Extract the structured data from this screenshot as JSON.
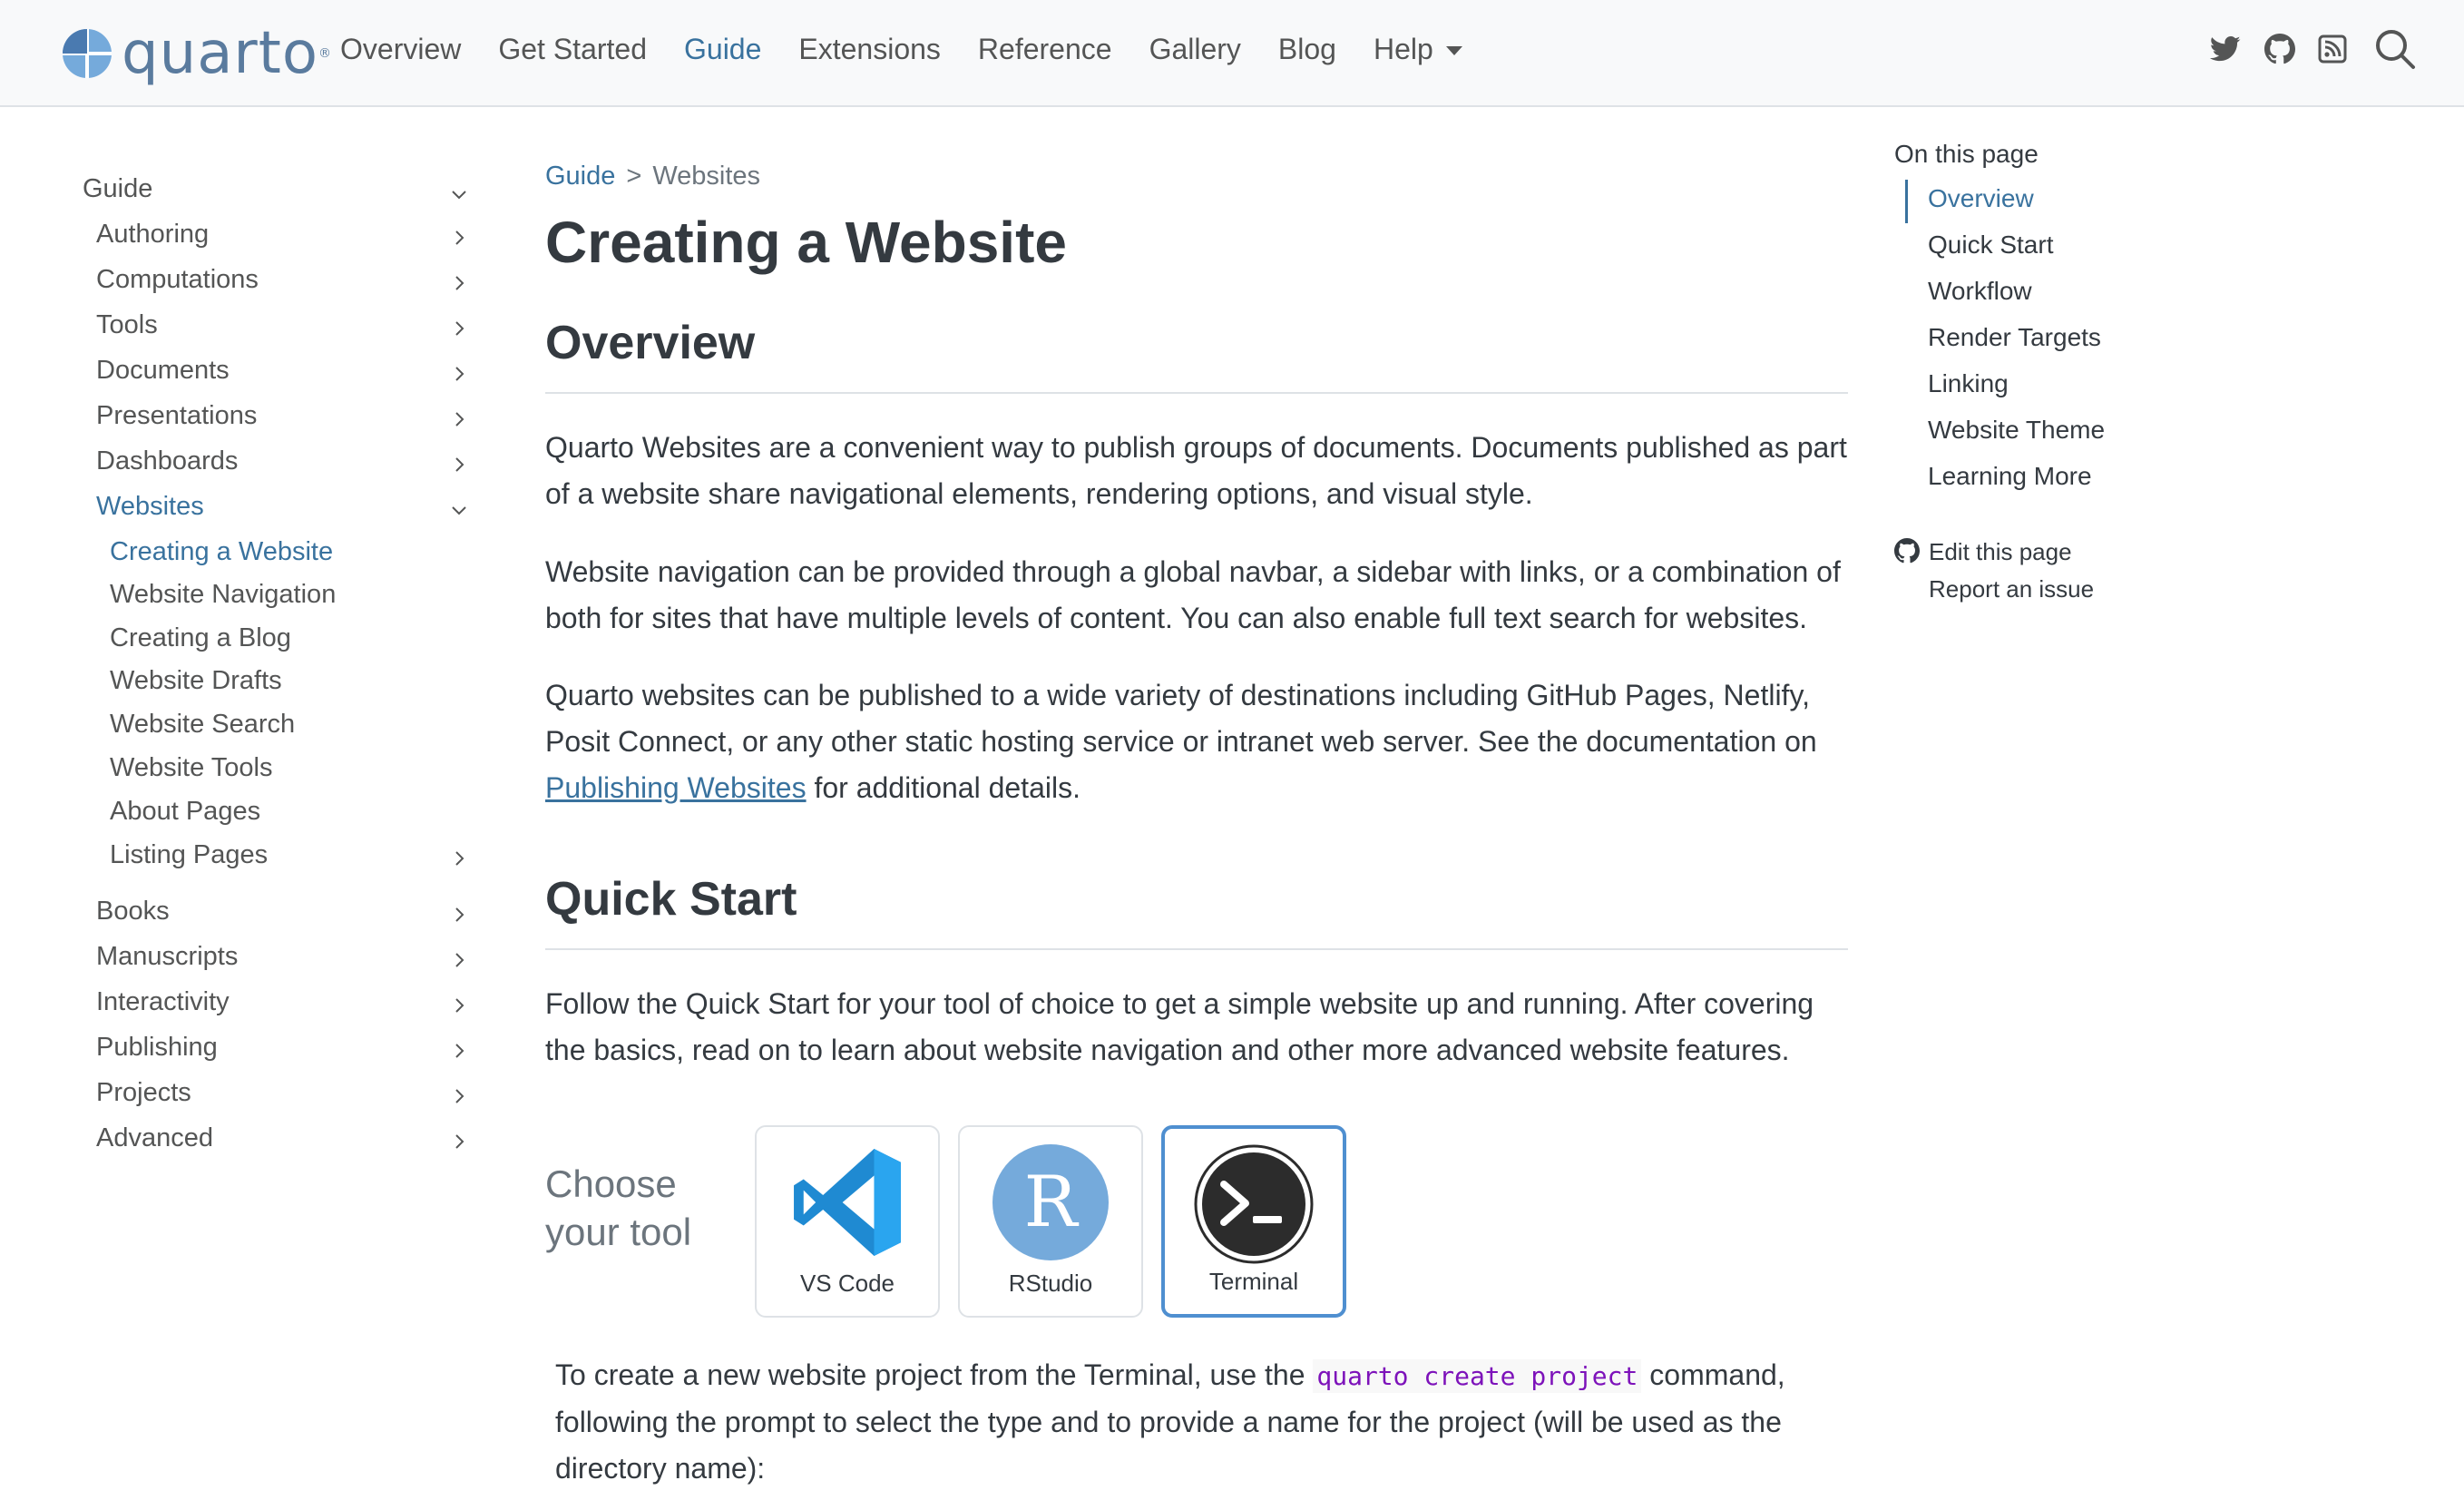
{
  "navbar": {
    "brand": "quarto",
    "brand_mark": "®",
    "links": [
      "Overview",
      "Get Started",
      "Guide",
      "Extensions",
      "Reference",
      "Gallery",
      "Blog",
      "Help"
    ],
    "active_link": "Guide",
    "icons": [
      "twitter-icon",
      "github-icon",
      "rss-icon",
      "search-icon"
    ]
  },
  "sidebar": {
    "sections": [
      {
        "label": "Guide",
        "level": 0,
        "expanded": true
      },
      {
        "label": "Authoring",
        "level": 1,
        "expanded": false
      },
      {
        "label": "Computations",
        "level": 1,
        "expanded": false
      },
      {
        "label": "Tools",
        "level": 1,
        "expanded": false
      },
      {
        "label": "Documents",
        "level": 1,
        "expanded": false
      },
      {
        "label": "Presentations",
        "level": 1,
        "expanded": false
      },
      {
        "label": "Dashboards",
        "level": 1,
        "expanded": false
      },
      {
        "label": "Websites",
        "level": 1,
        "expanded": true,
        "active": true
      },
      {
        "label": "Creating a Website",
        "level": 2,
        "active": true
      },
      {
        "label": "Website Navigation",
        "level": 2
      },
      {
        "label": "Creating a Blog",
        "level": 2
      },
      {
        "label": "Website Drafts",
        "level": 2
      },
      {
        "label": "Website Search",
        "level": 2
      },
      {
        "label": "Website Tools",
        "level": 2
      },
      {
        "label": "About Pages",
        "level": 2
      },
      {
        "label": "Listing Pages",
        "level": 2,
        "expanded": false
      },
      {
        "label": "Books",
        "level": 1,
        "expanded": false
      },
      {
        "label": "Manuscripts",
        "level": 1,
        "expanded": false
      },
      {
        "label": "Interactivity",
        "level": 1,
        "expanded": false
      },
      {
        "label": "Publishing",
        "level": 1,
        "expanded": false
      },
      {
        "label": "Projects",
        "level": 1,
        "expanded": false
      },
      {
        "label": "Advanced",
        "level": 1,
        "expanded": false
      }
    ]
  },
  "breadcrumb": {
    "parent": "Guide",
    "separator": ">",
    "current": "Websites"
  },
  "page": {
    "title": "Creating a Website",
    "overview_heading": "Overview",
    "overview_p1": "Quarto Websites are a convenient way to publish groups of documents. Documents published as part of a website share navigational elements, rendering options, and visual style.",
    "overview_p2": "Website navigation can be provided through a global navbar, a sidebar with links, or a combination of both for sites that have multiple levels of content. You can also enable full text search for websites.",
    "overview_p3_before": "Quarto websites can be published to a wide variety of destinations including GitHub Pages, Netlify, Posit Connect, or any other static hosting service or intranet web server. See the documentation on ",
    "overview_p3_link": "Publishing Websites",
    "overview_p3_after": " for additional details.",
    "quickstart_heading": "Quick Start",
    "quickstart_p1": "Follow the Quick Start for your tool of choice to get a simple website up and running. After covering the basics, read on to learn about website navigation and other more advanced website features.",
    "choose_line1": "Choose",
    "choose_line2": "your tool",
    "tools": [
      {
        "label": "VS Code",
        "icon": "vscode-icon",
        "selected": false
      },
      {
        "label": "RStudio",
        "icon": "rstudio-icon",
        "selected": false,
        "glyph": "R"
      },
      {
        "label": "Terminal",
        "icon": "terminal-icon",
        "selected": true
      }
    ],
    "terminal_p_before": "To create a new website project from the Terminal, use the ",
    "terminal_p_code": "quarto create project",
    "terminal_p_after": " command, following the prompt to select the type and to provide a name for the project (will be used as the directory name):"
  },
  "toc": {
    "title": "On this page",
    "items": [
      "Overview",
      "Quick Start",
      "Workflow",
      "Render Targets",
      "Linking",
      "Website Theme",
      "Learning More"
    ],
    "active": "Overview",
    "edit_label": "Edit this page",
    "issue_label": "Report an issue"
  },
  "colors": {
    "accent": "#39729e",
    "text": "#343a40",
    "muted": "#6c757d",
    "code": "#7d12ba",
    "navbar_bg": "#f8f9fa",
    "tool_selected": "#4f8fd0"
  }
}
